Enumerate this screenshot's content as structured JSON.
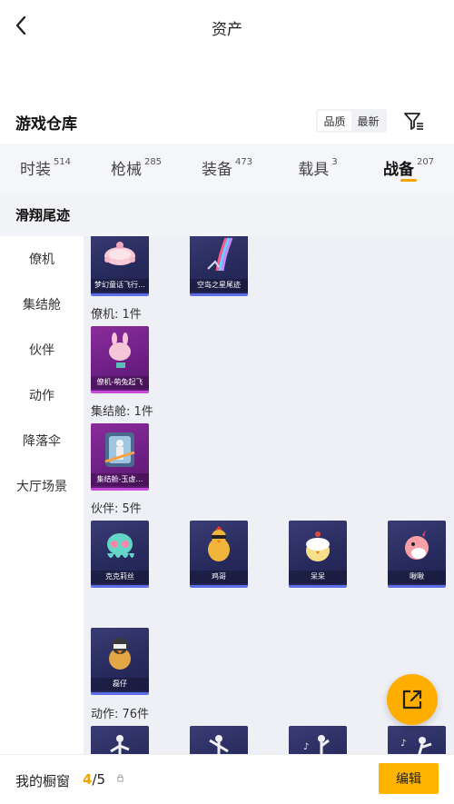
{
  "header": {
    "title": "资产"
  },
  "warehouse": {
    "title": "游戏仓库",
    "sort_options": [
      "品质",
      "最新"
    ],
    "active_sort": "品质"
  },
  "tabs": [
    {
      "label": "时装",
      "count": "514"
    },
    {
      "label": "枪械",
      "count": "285"
    },
    {
      "label": "装备",
      "count": "473"
    },
    {
      "label": "载具",
      "count": "3"
    },
    {
      "label": "战备",
      "count": "207",
      "active": true
    }
  ],
  "active_category": "滑翔尾迹",
  "sidebar": [
    "僚机",
    "集结舱",
    "伙伴",
    "动作",
    "降落伞",
    "大厅场景"
  ],
  "groups": {
    "trail_items": [
      "梦幻童话飞行…",
      "空岛之星尾迹"
    ],
    "wingman_label": "僚机: 1件",
    "wingman_items": [
      "僚机-萌兔起飞"
    ],
    "capsule_label": "集结舱: 1件",
    "capsule_items": [
      "集结舱-玉虚…"
    ],
    "partner_label": "伙伴: 5件",
    "partner_items": [
      "克克莉丝",
      "鸡哥",
      "呆呆",
      "啾啾",
      "磊仔"
    ],
    "action_label": "动作: 76件"
  },
  "bottom": {
    "label": "我的橱窗",
    "current": "4",
    "total": "/5",
    "edit_label": "编辑"
  },
  "colors": {
    "accent": "#ffb400",
    "card_blue": "#2b2e63",
    "card_purple": "#7a2590"
  }
}
